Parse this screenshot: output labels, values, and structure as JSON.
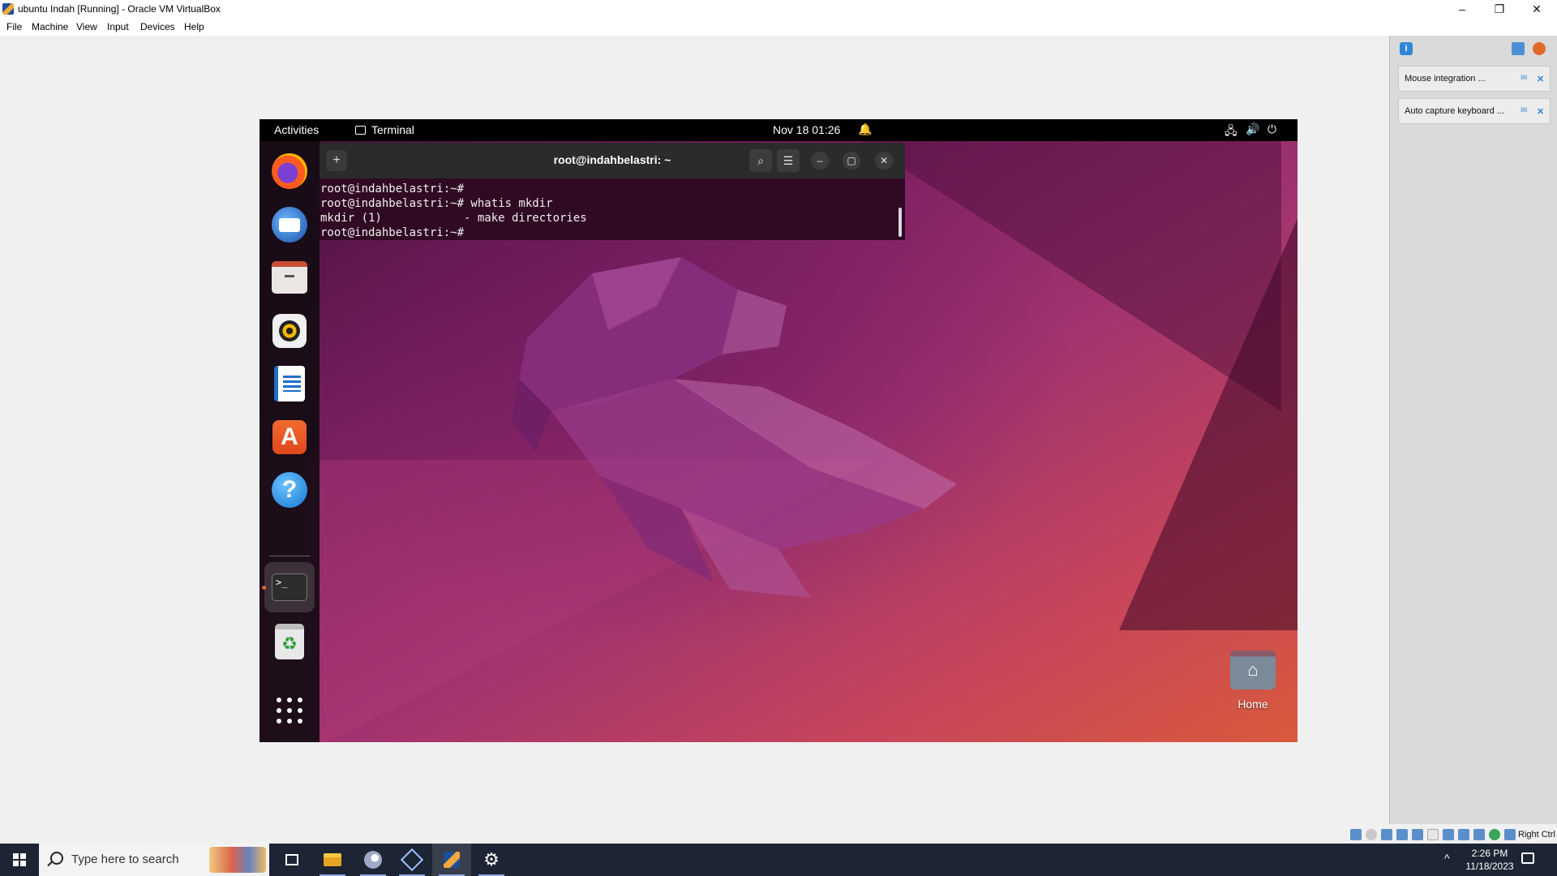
{
  "window": {
    "title": "ubuntu Indah [Running] - Oracle VM VirtualBox",
    "controls": {
      "minimize": "–",
      "restore": "❐",
      "close": "✕"
    }
  },
  "menu": [
    "File",
    "Machine",
    "View",
    "Input",
    "Devices",
    "Help"
  ],
  "guest": {
    "topbar": {
      "activities": "Activities",
      "app_name": "Terminal",
      "clock": "Nov 18  01:26",
      "icons": {
        "notification": "bell-icon",
        "network": "network-icon",
        "volume": "volume-icon",
        "power": "power-icon"
      },
      "glyphs": {
        "bell": "🔔",
        "network": "🖧",
        "volume": "🔊",
        "power": "⏻"
      }
    },
    "dock": {
      "apps": [
        "firefox-icon",
        "thunderbird-icon",
        "files-icon",
        "rhythmbox-icon",
        "writer-icon",
        "app-center-icon",
        "help-icon",
        "terminal-icon",
        "trash-icon"
      ],
      "store_glyph": "A",
      "help_glyph": "?",
      "terminal_glyph": ">_",
      "trash_glyph": "♻",
      "show_apps": "apps-grid-icon"
    },
    "terminal": {
      "title": "root@indahbelastri: ~",
      "new_tab_glyph": "+",
      "buttons": {
        "search": "⌕",
        "menu": "☰",
        "minimize": "–",
        "maximize": "▢",
        "close": "✕"
      },
      "lines": [
        "root@indahbelastri:~#",
        "root@indahbelastri:~# whatis mkdir",
        "mkdir (1)            - make directories",
        "root@indahbelastri:~#"
      ]
    },
    "desktop": {
      "home_label": "Home",
      "home_glyph": "⌂"
    }
  },
  "notifications": {
    "header_icon": "i",
    "items": [
      {
        "text": "Mouse integration ...",
        "glyph": "✉",
        "close": "✕"
      },
      {
        "text": "Auto capture keyboard ...",
        "glyph": "✉",
        "close": "✕"
      }
    ]
  },
  "statusbar": {
    "host_key": "Right Ctrl"
  },
  "taskbar": {
    "search_placeholder": "Type here to search",
    "settings_glyph": "⚙",
    "tray_chevron": "^",
    "time": "2:26 PM",
    "date": "11/18/2023"
  },
  "colors": {
    "terminal_bg": "#300a24",
    "ubuntu_orange": "#e95420",
    "taskbar_bg": "#1d2433"
  }
}
